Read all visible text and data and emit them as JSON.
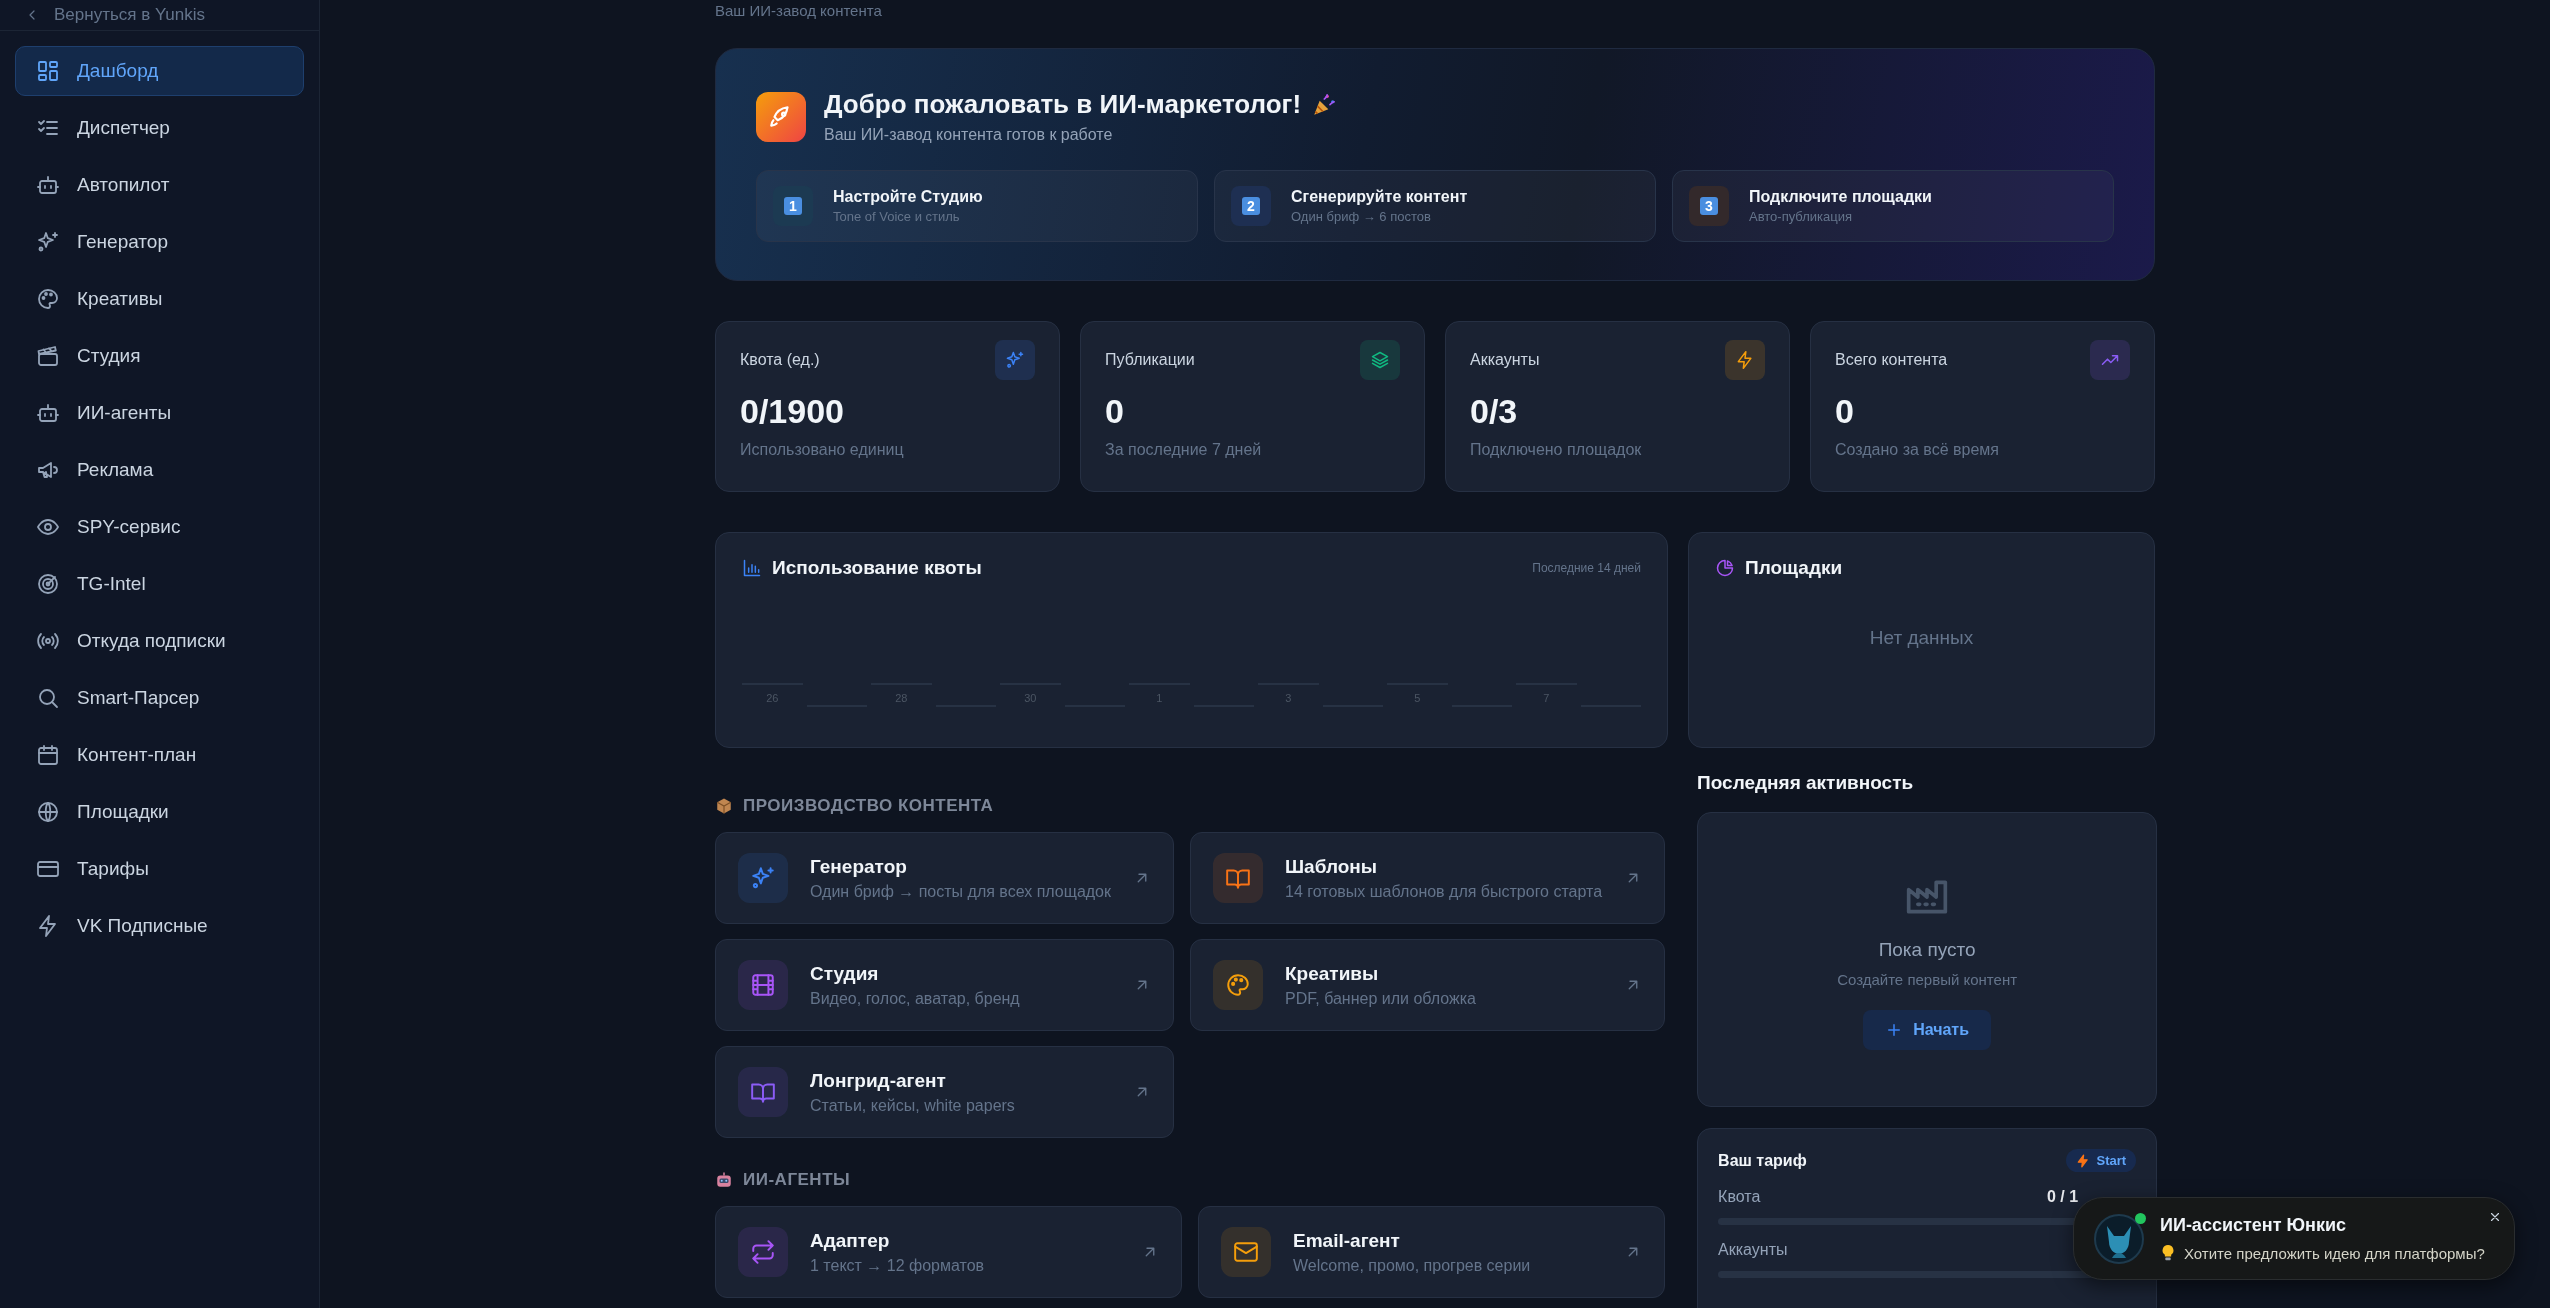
{
  "sidebar": {
    "back_link": "Вернуться в Yunkis",
    "items": [
      {
        "label": "Дашборд",
        "selected": true
      },
      {
        "label": "Диспетчер",
        "selected": false
      },
      {
        "label": "Автопилот",
        "selected": false
      },
      {
        "label": "Генератор",
        "selected": false
      },
      {
        "label": "Креативы",
        "selected": false
      },
      {
        "label": "Студия",
        "selected": false
      },
      {
        "label": "ИИ-агенты",
        "selected": false
      },
      {
        "label": "Реклама",
        "selected": false
      },
      {
        "label": "SPY-сервис",
        "selected": false
      },
      {
        "label": "TG-Intel",
        "selected": false
      },
      {
        "label": "Откуда подписки",
        "selected": false
      },
      {
        "label": "Smart-Парсер",
        "selected": false
      },
      {
        "label": "Контент-план",
        "selected": false
      },
      {
        "label": "Площадки",
        "selected": false
      },
      {
        "label": "Тарифы",
        "selected": false
      },
      {
        "label": "VK Подписные",
        "selected": false
      }
    ]
  },
  "page_subtitle": "Ваш ИИ-завод контента",
  "welcome": {
    "title": "Добро пожаловать в ИИ-маркетолог!",
    "subtitle": "Ваш ИИ-завод контента готов к работе",
    "steps": [
      {
        "number": "1",
        "title": "Настройте Студию",
        "subtitle": "Tone of Voice и стиль",
        "color": "#1c3a52"
      },
      {
        "number": "2",
        "title": "Сгенерируйте контент",
        "subtitle": "Один бриф → 6 постов",
        "color": "#1e2f52"
      },
      {
        "number": "3",
        "title": "Подключите площадки",
        "subtitle": "Авто-публикация",
        "color": "#33292b"
      }
    ]
  },
  "stats": [
    {
      "label": "Квота (ед.)",
      "value": "0/1900",
      "caption": "Использовано единиц",
      "color": "#3b82f6"
    },
    {
      "label": "Публикации",
      "value": "0",
      "caption": "За последние 7 дней",
      "color": "#10b981"
    },
    {
      "label": "Аккаунты",
      "value": "0/3",
      "caption": "Подключено площадок",
      "color": "#f59e0b"
    },
    {
      "label": "Всего контента",
      "value": "0",
      "caption": "Создано за всё время",
      "color": "#8b5cf6"
    }
  ],
  "quota_chart": {
    "title": "Использование квоты",
    "range": "Последние 14 дней",
    "day_labels": [
      "26",
      "28",
      "30",
      "1",
      "3",
      "5",
      "7"
    ]
  },
  "platforms": {
    "title": "Площадки",
    "empty_text": "Нет данных"
  },
  "sections": [
    {
      "title": "ПРОИЗВОДСТВО КОНТЕНТА",
      "cards": [
        {
          "title": "Генератор",
          "subtitle": "Один бриф → посты для всех площадок",
          "color": "#3b82f6"
        },
        {
          "title": "Шаблоны",
          "subtitle": "14 готовых шаблонов для быстрого старта",
          "color": "#f97316"
        },
        {
          "title": "Студия",
          "subtitle": "Видео, голос, аватар, бренд",
          "color": "#a855f7"
        },
        {
          "title": "Креативы",
          "subtitle": "PDF, баннер или обложка",
          "color": "#f59e0b"
        },
        {
          "title": "Лонгрид-агент",
          "subtitle": "Статьи, кейсы, white papers",
          "color": "#8b5cf6"
        }
      ]
    },
    {
      "title": "ИИ-АГЕНТЫ",
      "cards": [
        {
          "title": "Адаптер",
          "subtitle": "1 текст → 12 форматов",
          "color": "#a855f7"
        },
        {
          "title": "Email-агент",
          "subtitle": "Welcome, промо, прогрев серии",
          "color": "#f59e0b"
        }
      ]
    }
  ],
  "activity": {
    "title": "Последняя активность",
    "empty_title": "Пока пусто",
    "empty_subtitle": "Создайте первый контент",
    "button": "Начать"
  },
  "tariff": {
    "title": "Ваш тариф",
    "plan": "Start",
    "meters": [
      {
        "label": "Квота",
        "reading": "0 / 1"
      },
      {
        "label": "Аккаунты"
      }
    ]
  },
  "assistant": {
    "title": "ИИ-ассистент Юнкис",
    "message": "Хотите предложить идею для платформы?",
    "online": true
  }
}
